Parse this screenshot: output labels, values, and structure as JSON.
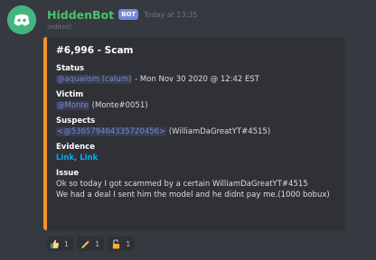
{
  "message": {
    "author": "HiddenBot",
    "bot_tag": "BOT",
    "timestamp": "Today at 13:35",
    "edited": "(edited)",
    "avatar_icon": "discord-logo-icon"
  },
  "embed": {
    "accent_color": "#f0932b",
    "title": "#6,996 - Scam",
    "status": {
      "label": "Status",
      "mention": "@aquaiism (calum)",
      "rest": " - Mon Nov 30 2020 @ 12:42 EST"
    },
    "victim": {
      "label": "Victim",
      "mention": "@Monte",
      "rest": " (Monte#0051)"
    },
    "suspects": {
      "label": "Suspects",
      "mention": "<@536579464335720456>",
      "rest": " (WilliamDaGreatYT#4515)"
    },
    "evidence": {
      "label": "Evidence",
      "link1": "Link",
      "sep": ", ",
      "link2": "Link"
    },
    "issue": {
      "label": "Issue",
      "line1": "Ok so today I got scammed by a certain WilliamDaGreatYT#4515",
      "line2": "We had a deal I sent him the model and he didnt pay me.(1000 bobux)"
    }
  },
  "reactions": [
    {
      "icon": "thumbs-up-icon",
      "count": "1"
    },
    {
      "icon": "pencil-icon",
      "count": "1"
    },
    {
      "icon": "unlock-icon",
      "count": "1"
    }
  ]
}
